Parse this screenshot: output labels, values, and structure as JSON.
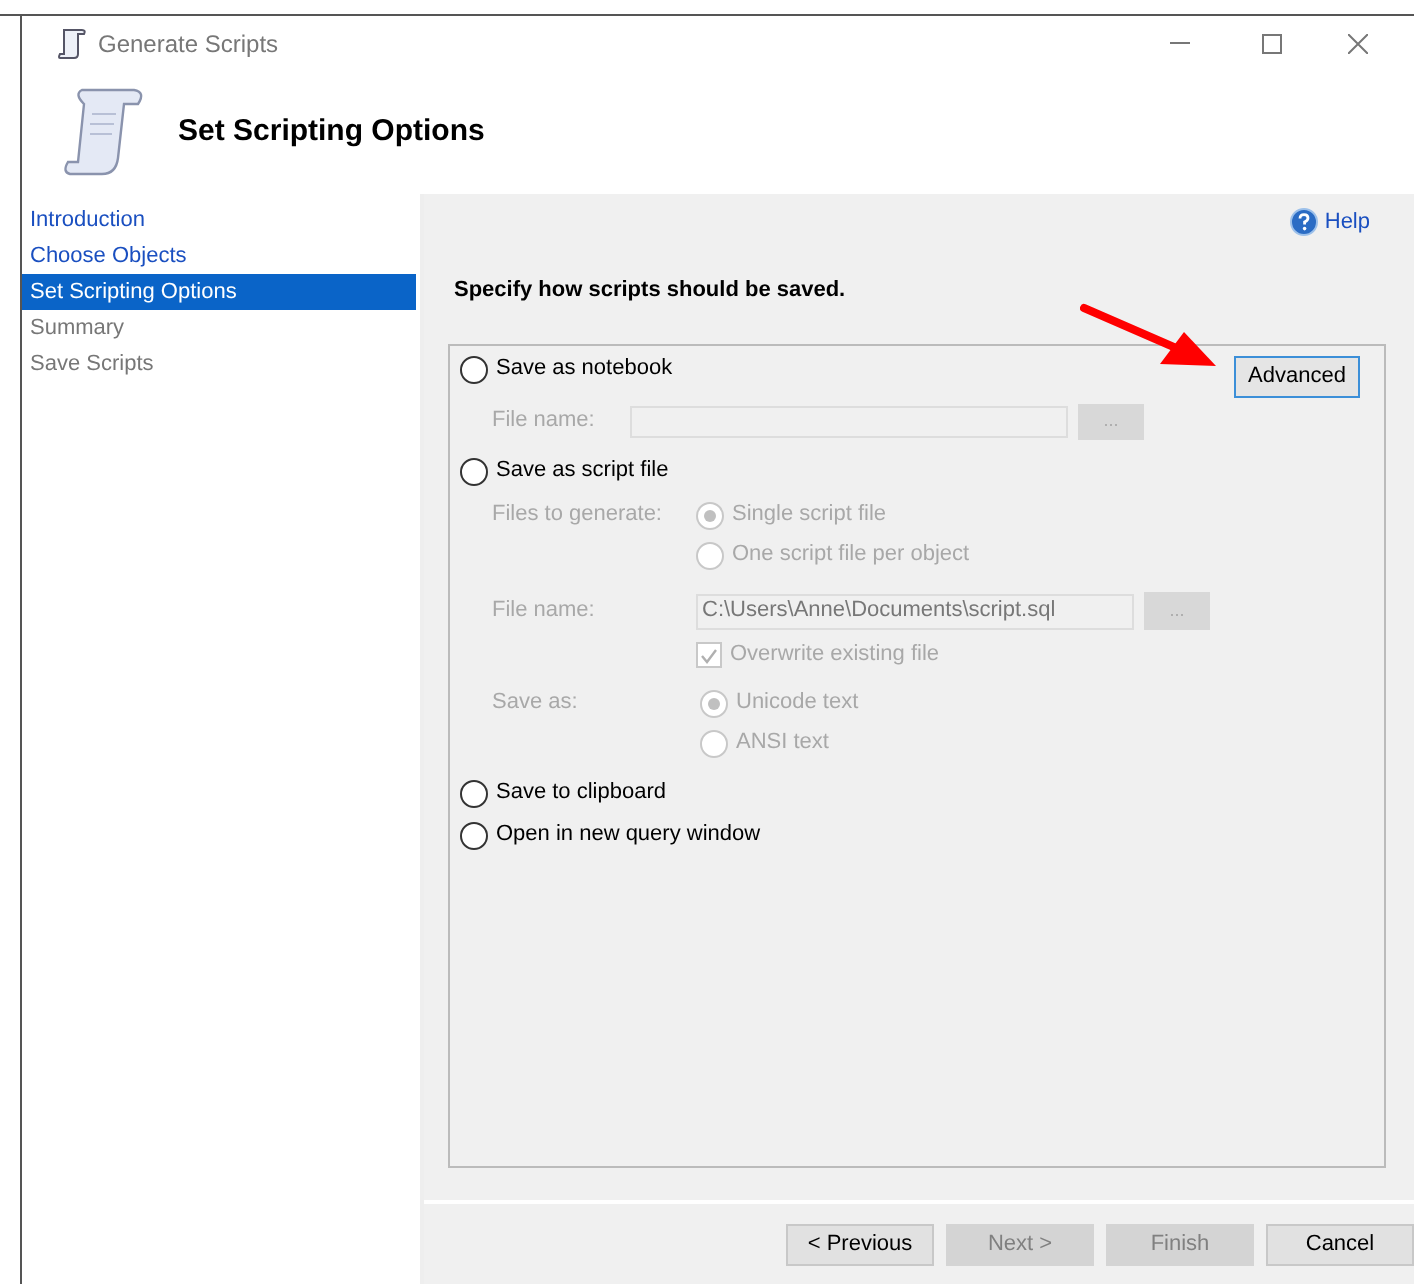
{
  "window": {
    "title": "Generate Scripts"
  },
  "header": {
    "title": "Set Scripting Options"
  },
  "nav": [
    {
      "label": "Introduction",
      "selected": false,
      "disabled": false
    },
    {
      "label": "Choose Objects",
      "selected": false,
      "disabled": false
    },
    {
      "label": "Set Scripting Options",
      "selected": true,
      "disabled": false
    },
    {
      "label": "Summary",
      "selected": false,
      "disabled": true
    },
    {
      "label": "Save Scripts",
      "selected": false,
      "disabled": true
    }
  ],
  "help": "Help",
  "instruction": "Specify how scripts should be saved.",
  "advanced": "Advanced",
  "notebook": {
    "label": "Save as notebook",
    "selected": false,
    "file_label": "File name:",
    "browse": "..."
  },
  "script_file": {
    "label": "Save as script file",
    "selected": false,
    "files_label": "Files to generate:",
    "files_options": [
      {
        "label": "Single script file",
        "selected": true
      },
      {
        "label": "One script file per object",
        "selected": false
      }
    ],
    "file_label": "File name:",
    "file_value": "C:\\Users\\Anne\\Documents\\script.sql",
    "browse": "...",
    "overwrite": {
      "label": "Overwrite existing file",
      "checked": true
    },
    "save_as_label": "Save as:",
    "save_as_options": [
      {
        "label": "Unicode text",
        "selected": true
      },
      {
        "label": "ANSI text",
        "selected": false
      }
    ]
  },
  "clipboard": {
    "label": "Save to clipboard",
    "selected": false
  },
  "query_window": {
    "label": "Open in new query window",
    "selected": false
  },
  "buttons": [
    {
      "label": "< Previous",
      "disabled": false
    },
    {
      "label": "Next >",
      "disabled": true
    },
    {
      "label": "Finish",
      "disabled": true
    },
    {
      "label": "Cancel",
      "disabled": false
    }
  ]
}
